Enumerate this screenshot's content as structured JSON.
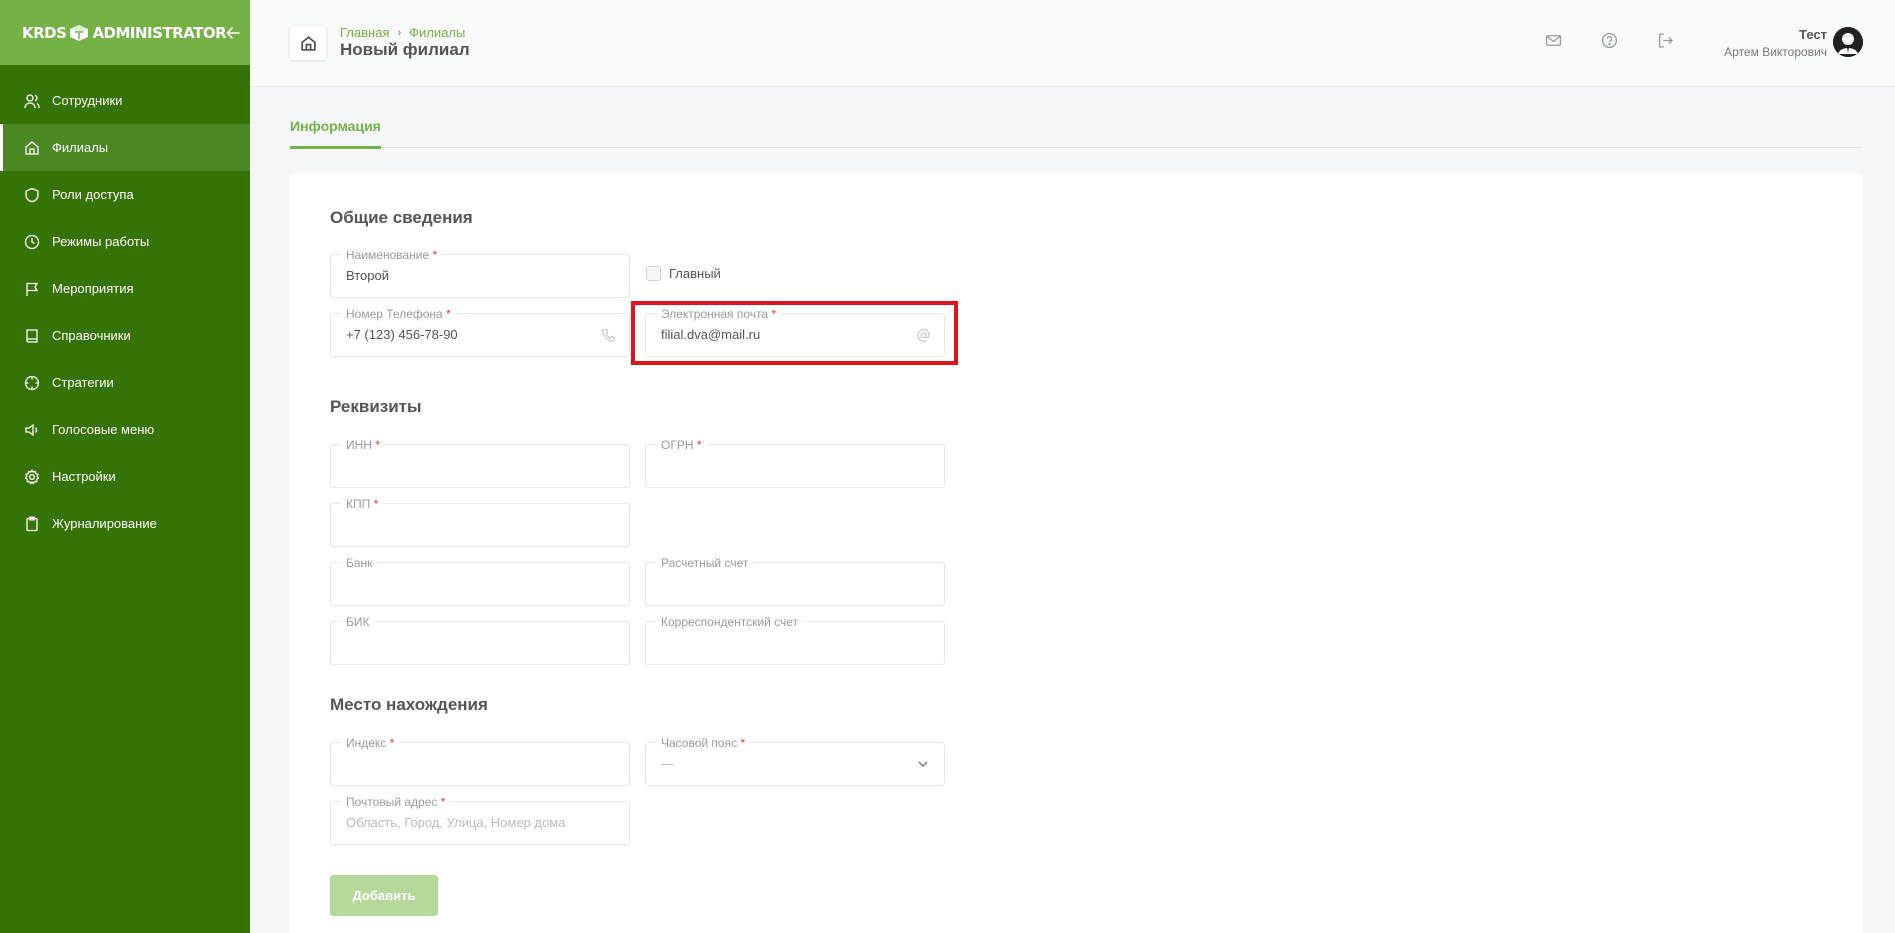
{
  "app": {
    "logo_left": "KRDS",
    "logo_right": "ADMINISTRATOR"
  },
  "sidebar": {
    "items": [
      {
        "label": "Сотрудники",
        "icon": "users-icon"
      },
      {
        "label": "Филиалы",
        "icon": "home-icon",
        "active": true
      },
      {
        "label": "Роли доступа",
        "icon": "shield-icon"
      },
      {
        "label": "Режимы работы",
        "icon": "clock-icon"
      },
      {
        "label": "Мероприятия",
        "icon": "flag-icon"
      },
      {
        "label": "Справочники",
        "icon": "book-icon"
      },
      {
        "label": "Стратегии",
        "icon": "crosshair-icon"
      },
      {
        "label": "Голосовые меню",
        "icon": "speaker-icon"
      },
      {
        "label": "Настройки",
        "icon": "gear-icon"
      },
      {
        "label": "Журналирование",
        "icon": "clipboard-icon"
      }
    ]
  },
  "header": {
    "breadcrumb": [
      "Главная",
      "Филиалы"
    ],
    "title": "Новый филиал",
    "user_name": "Тест",
    "user_fullname": "Артем Викторович"
  },
  "tabs": [
    {
      "label": "Информация"
    }
  ],
  "form": {
    "general": {
      "title": "Общие сведения",
      "name_label": "Наименование",
      "name_value": "Второй",
      "main_checkbox_label": "Главный",
      "phone_label": "Номер Телефона",
      "phone_value": "+7 (123) 456-78-90",
      "email_label": "Электронная почта",
      "email_value": "filial.dva@mail.ru"
    },
    "requisites": {
      "title": "Реквизиты",
      "inn_label": "ИНН",
      "ogrn_label": "ОГРН",
      "kpp_label": "КПП",
      "bank_label": "Банк",
      "account_label": "Расчетный счет",
      "bik_label": "БИК",
      "corr_label": "Корреспондентский счет"
    },
    "location": {
      "title": "Место нахождения",
      "index_label": "Индекс",
      "timezone_label": "Часовой пояс",
      "timezone_value": "—",
      "address_label": "Почтовый адрес",
      "address_placeholder": "Область, Город, Улица, Номер дома"
    },
    "submit_label": "Добавить"
  },
  "colors": {
    "sidebar": "#367307",
    "accent": "#74b146",
    "highlight": "#e0141d"
  }
}
